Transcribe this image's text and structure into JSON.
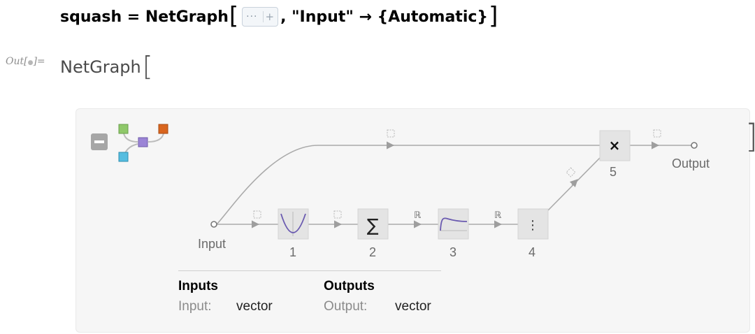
{
  "input": {
    "prefix": "squash = NetGraph",
    "open_bracket": "[",
    "close_bracket": "]",
    "iconized_dots": "···",
    "iconized_plus": "+",
    "suffix": ", \"Input\" → {Automatic}"
  },
  "output": {
    "label": "Out[",
    "label_dot": "●",
    "label_end": "]=",
    "head": "NetGraph",
    "open_bracket": "[",
    "close_bracket": "]"
  },
  "graph": {
    "collapse_icon": "minus-icon",
    "logo_icon": "netgraph-layer-icon",
    "logo_colors": [
      "#8fc86a",
      "#d9651e",
      "#9b84d6",
      "#56bde0"
    ],
    "node_fill": "#e4e4e4",
    "edge_color": "#aaaaaa",
    "input_label": "Input",
    "output_label": "Output",
    "edge_label_real": "ℝ",
    "nodes": [
      {
        "number": "1",
        "icon": "parabola-icon"
      },
      {
        "number": "2",
        "symbol": "∑"
      },
      {
        "number": "3",
        "icon": "saturation-curve-icon"
      },
      {
        "number": "4",
        "symbol": "⋮"
      },
      {
        "number": "5",
        "symbol": "×"
      }
    ]
  },
  "info": {
    "inputs_title": "Inputs",
    "outputs_title": "Outputs",
    "input_key": "Input:",
    "input_value": "vector",
    "output_key": "Output:",
    "output_value": "vector"
  }
}
